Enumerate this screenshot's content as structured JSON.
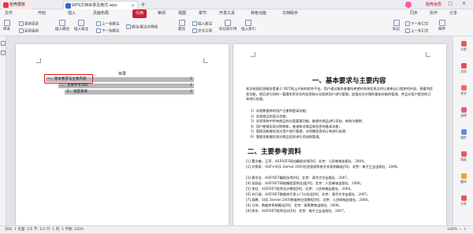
{
  "tabs": {
    "home": "稻壳模板",
    "doc": "WPS文档目录及格式.wps",
    "add": "+"
  },
  "window": {
    "controls": "— □ ✕",
    "user": "稻壳会员"
  },
  "menu": [
    "文件",
    "开始",
    "插入",
    "页面布局",
    "引用",
    "审阅",
    "视图",
    "章节",
    "开发工具",
    "特色功能",
    "文档助手"
  ],
  "menu_active_index": 4,
  "menu_right": [
    "同步",
    "协作",
    "分享"
  ],
  "ribbon": {
    "toc": "目录",
    "update_toc": "更新目录",
    "toc_level": "目录级别",
    "footnote": "插入脚注",
    "endnote": "插入尾注",
    "prev_footnote": "上一条脚注",
    "next_footnote": "下一条脚注",
    "footnote_sep": "脚注/尾注分隔线",
    "caption": "题注",
    "insert_caption": "插入题注",
    "cross_ref": "交叉引用",
    "mark_entry": "标记索引项",
    "insert_index": "插入索引",
    "mark_citation": "标记",
    "next_ref": "下一条引文",
    "prev_ref": "上一条引文",
    "mail": "邮件"
  },
  "toc": {
    "title": "目录",
    "rows": [
      {
        "label": "一、基本要求与主要内容",
        "page": "1"
      },
      {
        "label": "二、主要参考资料",
        "page": "1"
      },
      {
        "label": "三、进度安排",
        "page": "2"
      }
    ]
  },
  "doc": {
    "heading1": "一、基本要求与主要内容",
    "intro": "本次校园信息服务是基于.NET网上开始的综合平台，用户通过服务查看所希望的系统信息及时以便来自己相关的外部，直看到信息功能，然后进行网的一管理所资学员的信息统计及相关用户进行管理。加强对在外围的基本技能的管理，并且对用户提交的订单进行处理。",
    "items": [
      "1）实现数据库的用户注册和登录功能；",
      "2）实现商品的显示功能；",
      "3）实现系统中所有商品的分类管理功能，能够对商品进行添加、修改与删除；",
      "4）用户能够实现对购物车，查询和对商品和信息的基本功能；",
      "5）管理员能够实现对用户进行管理，对所属信息的订单进行处理；",
      "6）管理员能够实现对商品信息进行添加和管理。"
    ],
    "heading2": "二、主要参考资料",
    "refs": [
      "[1] 董文敏，王萍．ASP.NET网站编程实例[M]．北京：人民邮电出版社．2009。",
      "[2] 刘荣泉．ASP+SQL Server 2005信息管理系统开发案例精选[M]．北京：电子工业出版社．2008。",
      "[3] 杨学全．ASP.NET编程技术[M]．北京：清华大学出版社．2007。",
      "[4] 张跃廷．ASP.NET网络编程案例实战[M]．北京：人民邮电出版社．2008。",
      "[5] 李红．ASP.NET程序设计教程[M]．北京：人民邮电出版社．2008。",
      "[6] 刘乃丽．ASP.NET数据库开发入门与实战[M]．北京：清华大学出版社．2007。",
      "[7] 高鹏．SQL Server 2005数据库应用教程[M]．北京：人民邮电出版社．2008。",
      "[8] 马伟．数据库系统概论[M]．北京：高等教育出版社．2006。",
      "[9] 陈东．ASP.NET程序设计[M]．北京：电子工业出版社．2007。"
    ]
  },
  "right_sidebar": [
    "分类",
    "文档",
    "样式",
    "选择",
    "属性",
    "帮助",
    "翻译",
    "分享"
  ],
  "status": {
    "left": "页码: 1  页面: 1/5  节: 1/1  行: 1  列: 1  字数: 1020",
    "right": "100%  －  ＋"
  },
  "colors": {
    "accent": "#c9203b",
    "highlight_box": "#e0191b",
    "toc_fill": "#b8b8ba"
  }
}
